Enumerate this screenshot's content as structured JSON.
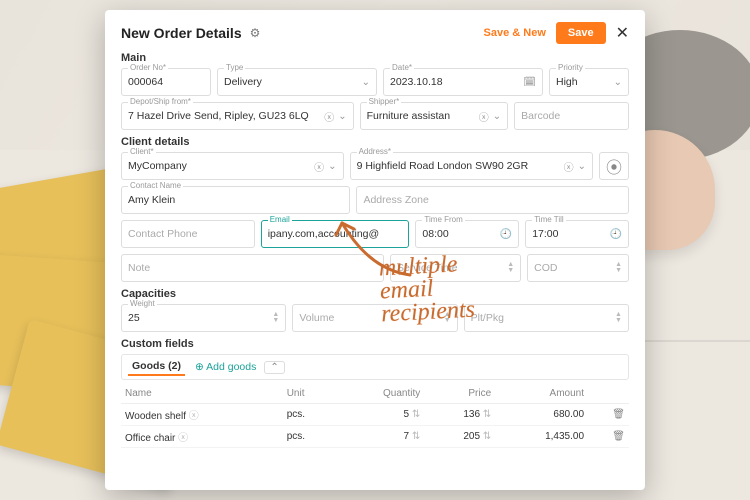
{
  "header": {
    "title": "New Order Details",
    "save_new": "Save & New",
    "save": "Save"
  },
  "sections": {
    "main": "Main",
    "client": "Client details",
    "capacities": "Capacities",
    "custom": "Custom fields"
  },
  "main": {
    "order_no_label": "Order No*",
    "order_no": "000064",
    "type_label": "Type",
    "type": "Delivery",
    "date_label": "Date*",
    "date": "2023.10.18",
    "priority_label": "Priority",
    "priority": "High",
    "depot_label": "Depot/Ship from*",
    "depot": "7 Hazel Drive Send, Ripley, GU23 6LQ",
    "shipper_label": "Shipper*",
    "shipper": "Furniture assistan",
    "barcode_ph": "Barcode"
  },
  "client": {
    "client_label": "Client*",
    "client": "MyCompany",
    "address_label": "Address*",
    "address": "9 Highfield Road London SW90 2GR",
    "contact_name_label": "Contact Name",
    "contact_name": "Amy Klein",
    "zone_ph": "Address Zone",
    "phone_ph": "Contact Phone",
    "email_label": "Email",
    "email": "ipany.com,accounting@",
    "time_from_label": "Time From",
    "time_from": "08:00",
    "time_till_label": "Time Till",
    "time_till": "17:00",
    "note_ph": "Note",
    "service_ph": "Service Time",
    "cod_ph": "COD"
  },
  "cap": {
    "weight_label": "Weight",
    "weight": "25",
    "volume_ph": "Volume",
    "plt_ph": "Plt/Pkg"
  },
  "goods": {
    "tab": "Goods (2)",
    "add": "Add goods",
    "cols": {
      "name": "Name",
      "unit": "Unit",
      "qty": "Quantity",
      "price": "Price",
      "amount": "Amount"
    },
    "rows": [
      {
        "name": "Wooden shelf",
        "unit": "pcs.",
        "qty": "5",
        "price": "136",
        "amount": "680.00"
      },
      {
        "name": "Office chair",
        "unit": "pcs.",
        "qty": "7",
        "price": "205",
        "amount": "1,435.00"
      }
    ]
  },
  "annotation": "multiple\nemail\nrecipients"
}
